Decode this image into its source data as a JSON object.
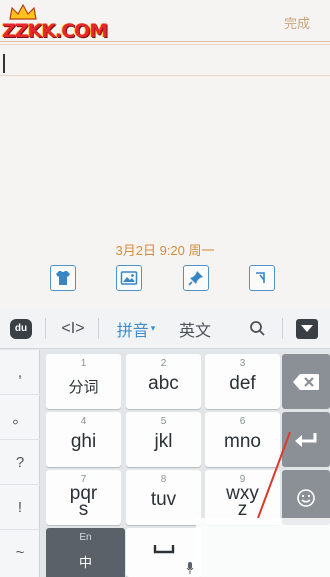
{
  "header": {
    "logo_text": "ZZKK.COM",
    "done_label": "完成"
  },
  "note": {
    "datetime": "3月2日 9:20 周一"
  },
  "tools": [
    {
      "name": "theme-shirt-icon"
    },
    {
      "name": "image-icon"
    },
    {
      "name": "pin-icon"
    },
    {
      "name": "clock-icon"
    }
  ],
  "keyboard_bar": {
    "logo": "du",
    "cursor_symbol": "<I>",
    "pinyin_label": "拼音",
    "pinyin_caret": "▾",
    "english_label": "英文",
    "search_symbol": "Q"
  },
  "symbols": [
    ",",
    "。",
    "?",
    "!",
    "~"
  ],
  "keys": [
    {
      "num": "1",
      "label": "分词"
    },
    {
      "num": "2",
      "label": "abc"
    },
    {
      "num": "3",
      "label": "def"
    },
    {
      "num": "4",
      "label": "ghi"
    },
    {
      "num": "5",
      "label": "jkl"
    },
    {
      "num": "6",
      "label": "mno"
    },
    {
      "num": "7",
      "label": "pqr\ns"
    },
    {
      "num": "8",
      "label": "tuv"
    },
    {
      "num": "9",
      "label": "wxy\nz"
    }
  ],
  "bottom_row": {
    "lang_top": "En",
    "lang_main": "中"
  },
  "colors": {
    "accent_blue": "#3b8fd0",
    "date_orange": "#d68a3c",
    "done_tan": "#c9a27d",
    "annotation_red": "#d93a2b"
  }
}
